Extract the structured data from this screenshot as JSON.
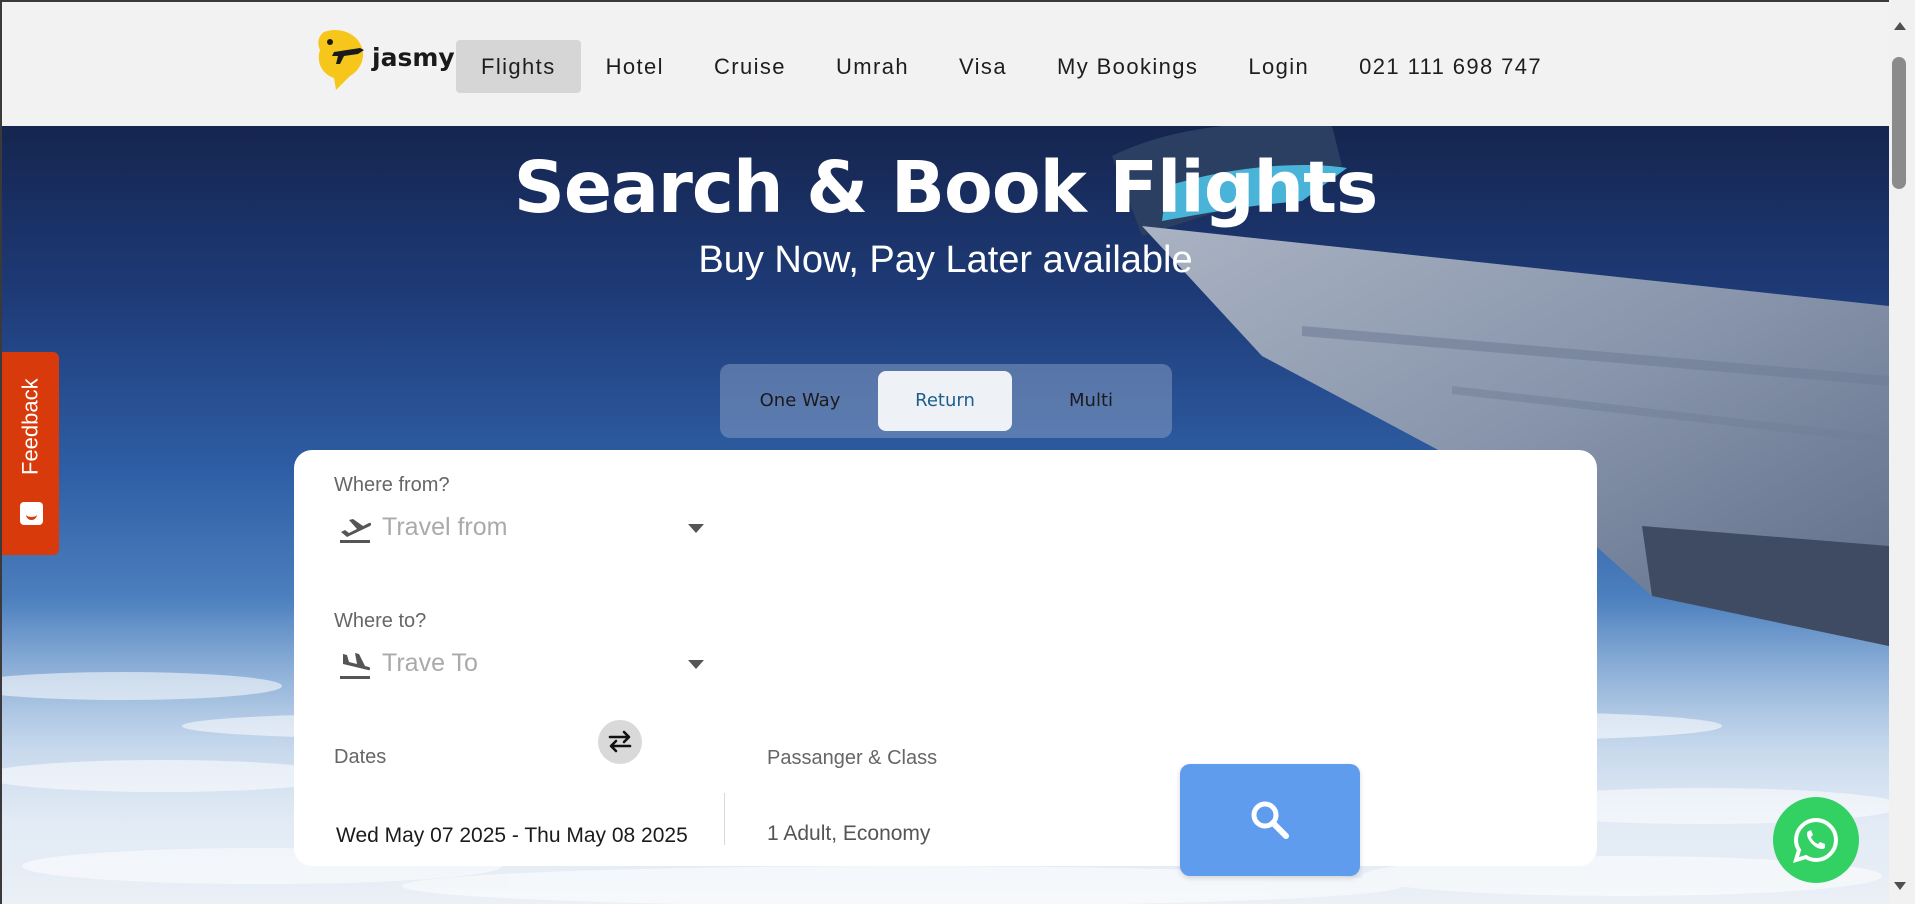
{
  "brand": {
    "logo_text": "jasmy"
  },
  "nav": {
    "items": [
      {
        "label": "Flights",
        "active": true
      },
      {
        "label": "Hotel"
      },
      {
        "label": "Cruise"
      },
      {
        "label": "Umrah"
      },
      {
        "label": "Visa"
      },
      {
        "label": "My Bookings"
      },
      {
        "label": "Login"
      },
      {
        "label": "021 111 698 747"
      }
    ]
  },
  "hero": {
    "title": "Search & Book Flights",
    "subtitle": "Buy Now, Pay Later available"
  },
  "trip_type": {
    "options": [
      "One Way",
      "Return",
      "Multi"
    ],
    "selected": "Return"
  },
  "search": {
    "from": {
      "label": "Where from?",
      "placeholder": "Travel from",
      "icon": "plane-takeoff-icon"
    },
    "to": {
      "label": "Where to?",
      "placeholder": "Trave To",
      "icon": "plane-landing-icon"
    },
    "swap_icon": "swap-arrows-icon",
    "dates": {
      "label": "Dates",
      "value": "Wed May 07 2025  -  Thu May 08 2025"
    },
    "passengers": {
      "label": "Passanger & Class",
      "value": "1 Adult, Economy"
    },
    "search_icon": "search-icon"
  },
  "feedback": {
    "label": "Feedback"
  },
  "colors": {
    "header_bg": "#f2f2f2",
    "search_button": "#5f9cee",
    "feedback": "#d83a0c",
    "whatsapp": "#33d163",
    "logo_yellow": "#f7c61b"
  }
}
